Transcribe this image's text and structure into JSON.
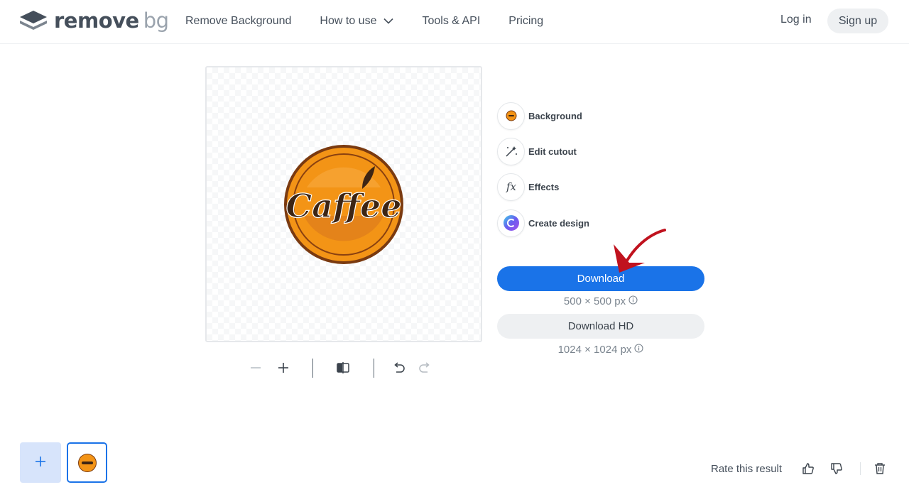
{
  "header": {
    "logo": {
      "word1": "remove",
      "word2": "bg",
      "icon": "layers-icon"
    },
    "nav": [
      {
        "label": "Remove Background"
      },
      {
        "label": "How to use",
        "icon": "chevron-down-icon"
      },
      {
        "label": "Tools & API"
      },
      {
        "label": "Pricing"
      }
    ],
    "login_label": "Log in",
    "signup_label": "Sign up"
  },
  "preview": {
    "image_text": "Caffee",
    "toolbar": {
      "icons": [
        "zoom-out-icon",
        "zoom-in-icon",
        "compare-icon",
        "undo-icon",
        "redo-icon"
      ]
    }
  },
  "options": [
    {
      "label": "Background",
      "icon": "background-thumbnail-icon"
    },
    {
      "label": "Edit cutout",
      "icon": "magic-brush-icon"
    },
    {
      "label": "Effects",
      "icon": "fx-icon"
    },
    {
      "label": "Create design",
      "icon": "canva-icon"
    }
  ],
  "download": {
    "label": "Download",
    "size": "500 × 500 px",
    "hd_label": "Download HD",
    "hd_size": "1024 × 1024 px"
  },
  "bottom": {
    "rate_label": "Rate this result",
    "icons": [
      "plus-icon",
      "thumbs-up-icon",
      "thumbs-down-icon",
      "trash-icon"
    ]
  },
  "colors": {
    "accent": "#1a73e8",
    "text": "#454f5b",
    "orange": "#f39416",
    "dark_brown": "#3d2514"
  }
}
